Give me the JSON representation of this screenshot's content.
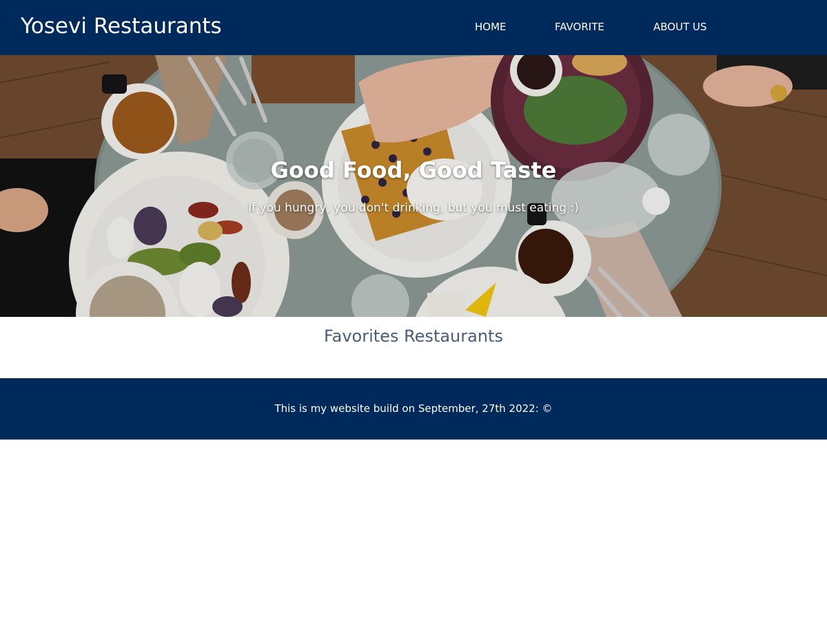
{
  "header": {
    "brand": "Yosevi Restaurants",
    "nav": [
      {
        "label": "HOME"
      },
      {
        "label": "FAVORITE"
      },
      {
        "label": "ABOUT US"
      }
    ]
  },
  "hero": {
    "title": "Good Food, Good Taste",
    "subtitle": "If you hungry, you don't drinking, but you must eating :)"
  },
  "main": {
    "section_title": "Favorites Restaurants"
  },
  "footer": {
    "text": "This is my website build on September, 27th 2022: ©"
  },
  "colors": {
    "navy": "#002a5c",
    "section_title": "#4a5c78",
    "white": "#ffffff"
  }
}
